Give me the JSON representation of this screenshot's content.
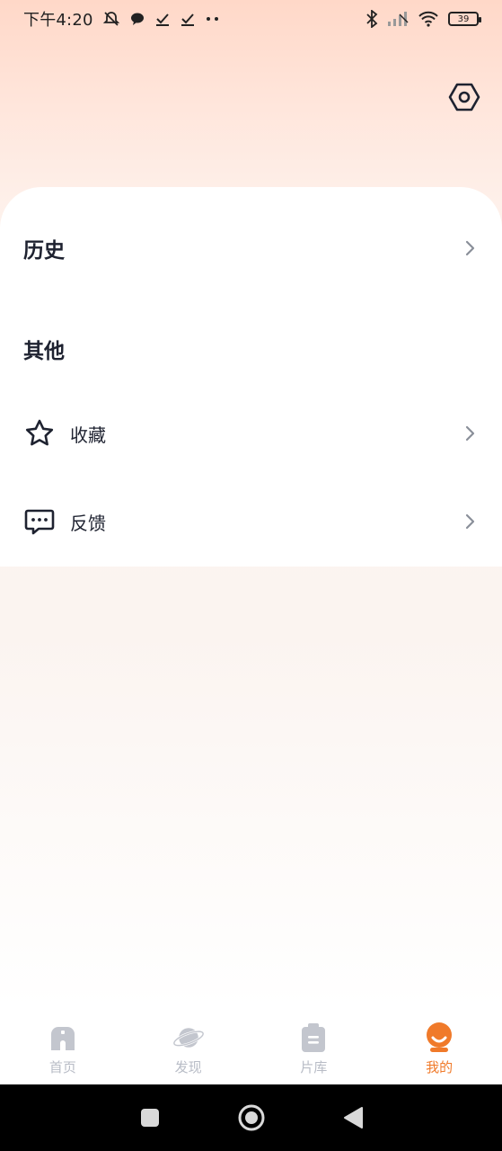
{
  "status_bar": {
    "time": "下午4:20",
    "battery": "39"
  },
  "menu": {
    "history_label": "历史",
    "other_section_title": "其他",
    "items": [
      {
        "label": "收藏",
        "icon": "star-icon"
      },
      {
        "label": "反馈",
        "icon": "chat-bubble-icon"
      }
    ]
  },
  "tabbar": {
    "tabs": [
      {
        "label": "首页",
        "icon": "home-icon",
        "active": false
      },
      {
        "label": "发现",
        "icon": "planet-icon",
        "active": false
      },
      {
        "label": "片库",
        "icon": "library-icon",
        "active": false
      },
      {
        "label": "我的",
        "icon": "profile-icon",
        "active": true
      }
    ]
  },
  "colors": {
    "accent": "#f07a2a",
    "inactive_tab": "#b8bcc6",
    "text": "#1e2230"
  }
}
